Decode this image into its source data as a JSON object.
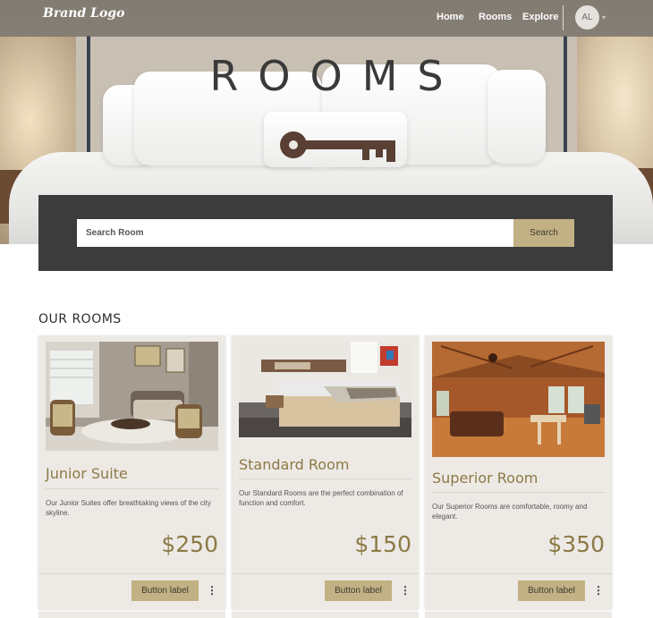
{
  "nav": {
    "brand": "Brand Logo",
    "links": [
      "Home",
      "Rooms",
      "Explore"
    ],
    "avatar_initials": "AL"
  },
  "hero": {
    "title": "ROOMS"
  },
  "search": {
    "placeholder": "Search Room",
    "button_label": "Search"
  },
  "section": {
    "title": "OUR ROOMS"
  },
  "cards": [
    {
      "title": "Junior Suite",
      "description": "Our Junior Suites offer breathtaking views of the city skyline.",
      "price": "$250",
      "button_label": "Button label"
    },
    {
      "title": "Standard Room",
      "description": "Our Standard Rooms are the perfect combination of function and comfort.",
      "price": "$150",
      "button_label": "Button label"
    },
    {
      "title": "Superior Room",
      "description": "Our Superior Rooms are comfortable, roomy and elegant.",
      "price": "$350",
      "button_label": "Button label"
    }
  ],
  "colors": {
    "accent": "#c2b184",
    "title_gold": "#8c7a45",
    "panel_dark": "#3c3c3c",
    "card_bg": "#ede9e5"
  },
  "icons": [
    "more-vert-icon",
    "chevron-down-icon"
  ]
}
